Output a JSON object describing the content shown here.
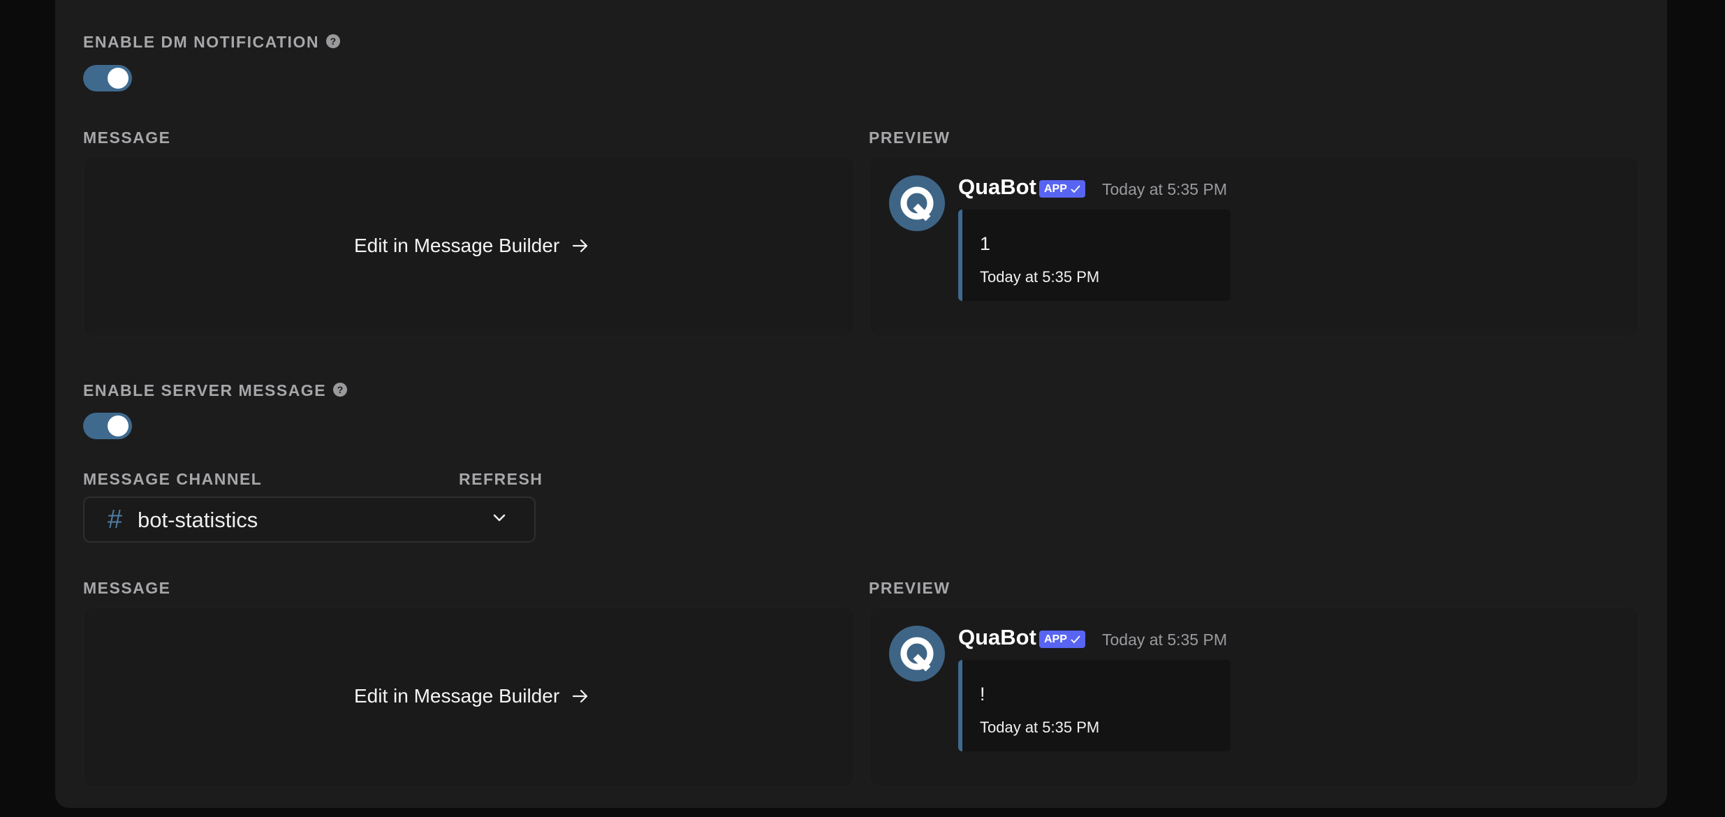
{
  "dm_section": {
    "label": "ENABLE DM NOTIFICATION",
    "help_icon": "?",
    "enabled": true,
    "message_label": "MESSAGE",
    "edit_label": "Edit in Message Builder",
    "preview_label": "PREVIEW",
    "preview": {
      "avatar_icon": "quabot-logo-icon",
      "bot_name": "QuaBot",
      "badge": "APP",
      "timestamp": "Today at 5:35 PM",
      "embed_description": "1",
      "embed_footer": "Today at 5:35 PM"
    }
  },
  "server_section": {
    "label": "ENABLE SERVER MESSAGE",
    "help_icon": "?",
    "enabled": true,
    "channel_label": "MESSAGE CHANNEL",
    "refresh_label": "REFRESH",
    "channel_hash": "#",
    "channel_value": "bot-statistics",
    "message_label": "MESSAGE",
    "edit_label": "Edit in Message Builder",
    "preview_label": "PREVIEW",
    "preview": {
      "avatar_icon": "quabot-logo-icon",
      "bot_name": "QuaBot",
      "badge": "APP",
      "timestamp": "Today at 5:35 PM",
      "embed_description": "!",
      "embed_footer": "Today at 5:35 PM"
    }
  },
  "colors": {
    "page_background": "#0b0b0c",
    "panel_background": "#1c1c1d",
    "toggle_on": "#3f6a8e",
    "badge": "#5865f2",
    "embed_accent": "#3f6a8e"
  }
}
